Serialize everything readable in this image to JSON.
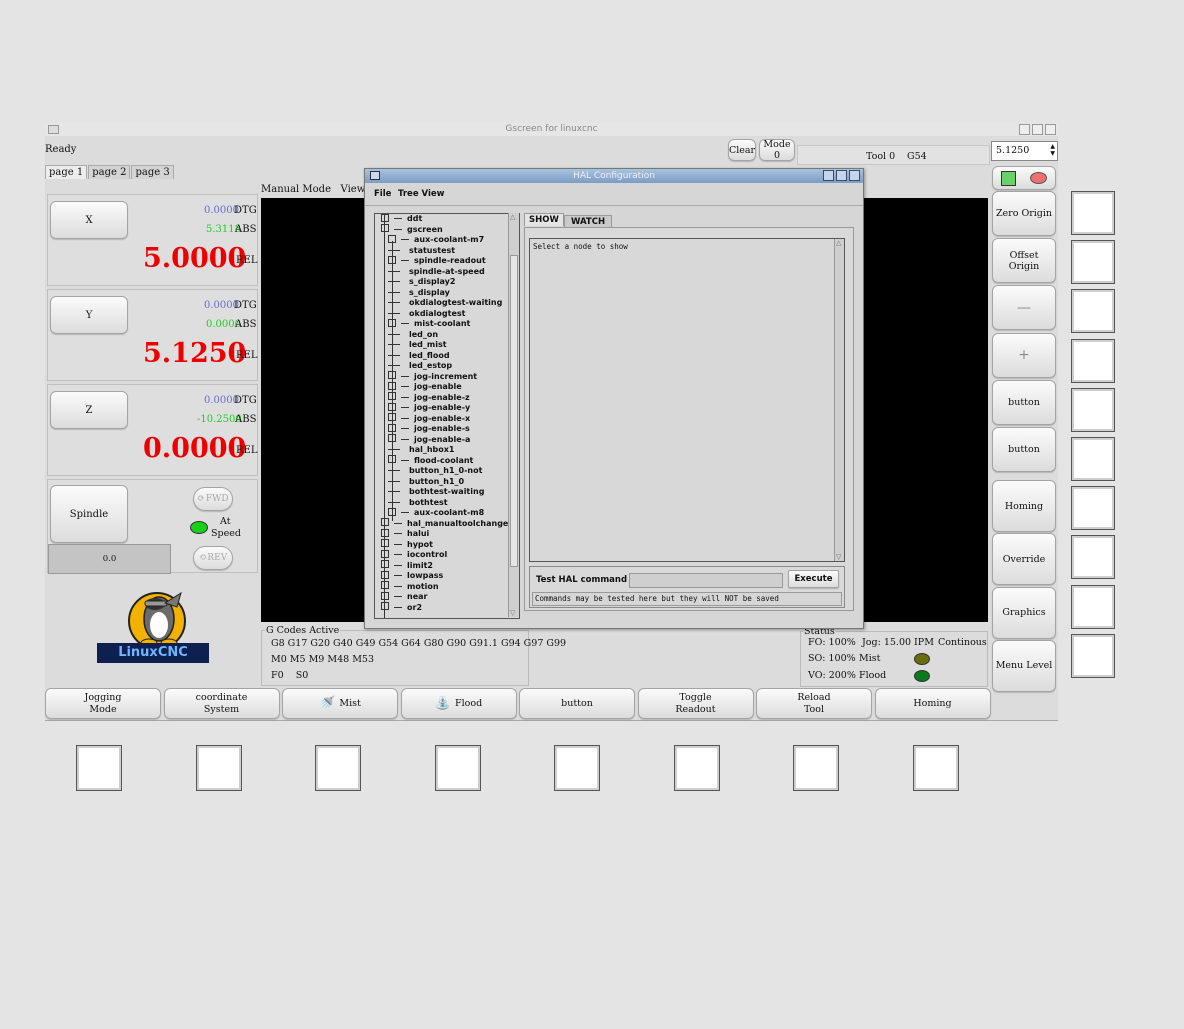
{
  "window": {
    "title": "Gscreen for linuxcnc",
    "status_text": "Ready",
    "clear_label": "Clear",
    "mode_label": "Mode 0",
    "tool_label": "Tool 0",
    "g54_label": "G54",
    "spin_value": "5.1250"
  },
  "tabs": [
    "page 1",
    "page 2",
    "page 3"
  ],
  "axes": [
    {
      "name": "X",
      "dtg": "0.0000",
      "abs": "5.3118",
      "rel": "5.0000",
      "dtg_label": "DTG",
      "abs_label": "ABS",
      "rel_label": "REL"
    },
    {
      "name": "Y",
      "dtg": "0.0000",
      "abs": "0.0000",
      "rel": "5.1250",
      "dtg_label": "DTG",
      "abs_label": "ABS",
      "rel_label": "REL"
    },
    {
      "name": "Z",
      "dtg": "0.0000",
      "abs": "-10.2500",
      "rel": "0.0000",
      "dtg_label": "DTG",
      "abs_label": "ABS",
      "rel_label": "REL"
    }
  ],
  "spindle": {
    "button": "Spindle",
    "fwd": "FWD",
    "rev": "REV",
    "at_speed_1": "At",
    "at_speed_2": "Speed",
    "speed_value": "0.0"
  },
  "logo_text": "LinuxCNC",
  "view": {
    "mode_text": "Manual Mode",
    "view_text": "View -P"
  },
  "gcodes": {
    "title": "G Codes Active",
    "line1": "G8 G17 G20 G40 G49 G54 G64 G80 G90 G91.1 G94 G97 G99",
    "line2": "M0 M5 M9 M48 M53",
    "line3": "F0    S0"
  },
  "status": {
    "title": "Status",
    "fo": "FO: 100%",
    "so": "SO: 100%",
    "vo": "VO: 200%",
    "jog": "Jog: 15.00 IPM",
    "continous": "Continous",
    "mist": "Mist",
    "flood": "Flood",
    "colors": {
      "mist": "#6b6b10",
      "flood": "#0a7a1a"
    }
  },
  "right_buttons": [
    "Zero Origin",
    "Offset Origin",
    "—",
    "+",
    "button",
    "button",
    "Homing",
    "Override",
    "Graphics",
    "Menu Level"
  ],
  "bottom_buttons": [
    {
      "l1": "Jogging",
      "l2": "Mode"
    },
    {
      "l1": "coordinate",
      "l2": "System"
    },
    {
      "l1": "Mist",
      "l2": ""
    },
    {
      "l1": "Flood",
      "l2": ""
    },
    {
      "l1": "button",
      "l2": ""
    },
    {
      "l1": "Toggle",
      "l2": "Readout"
    },
    {
      "l1": "Reload",
      "l2": "Tool"
    },
    {
      "l1": "Homing",
      "l2": ""
    }
  ],
  "hal": {
    "title": "HAL Configuration",
    "menu_file": "File",
    "menu_tree": "Tree View",
    "tab_show": "SHOW",
    "tab_watch": "WATCH",
    "show_text": "Select a node to show",
    "test_label": "Test HAL command :",
    "execute": "Execute",
    "note": "Commands may be tested here but they will NOT be saved",
    "tree": [
      {
        "label": "ddt",
        "level": 0,
        "exp": true
      },
      {
        "label": "gscreen",
        "level": 0,
        "exp": true
      },
      {
        "label": "aux-coolant-m7",
        "level": 1,
        "exp": true
      },
      {
        "label": "statustest",
        "level": 1,
        "exp": false
      },
      {
        "label": "spindle-readout",
        "level": 1,
        "exp": true
      },
      {
        "label": "spindle-at-speed",
        "level": 1,
        "exp": false
      },
      {
        "label": "s_display2",
        "level": 1,
        "exp": false
      },
      {
        "label": "s_display",
        "level": 1,
        "exp": false
      },
      {
        "label": "okdialogtest-waiting",
        "level": 1,
        "exp": false
      },
      {
        "label": "okdialogtest",
        "level": 1,
        "exp": false
      },
      {
        "label": "mist-coolant",
        "level": 1,
        "exp": true
      },
      {
        "label": "led_on",
        "level": 1,
        "exp": false
      },
      {
        "label": "led_mist",
        "level": 1,
        "exp": false
      },
      {
        "label": "led_flood",
        "level": 1,
        "exp": false
      },
      {
        "label": "led_estop",
        "level": 1,
        "exp": false
      },
      {
        "label": "jog-increment",
        "level": 1,
        "exp": true
      },
      {
        "label": "jog-enable",
        "level": 1,
        "exp": true
      },
      {
        "label": "jog-enable-z",
        "level": 1,
        "exp": true
      },
      {
        "label": "jog-enable-y",
        "level": 1,
        "exp": true
      },
      {
        "label": "jog-enable-x",
        "level": 1,
        "exp": true
      },
      {
        "label": "jog-enable-s",
        "level": 1,
        "exp": true
      },
      {
        "label": "jog-enable-a",
        "level": 1,
        "exp": true
      },
      {
        "label": "hal_hbox1",
        "level": 1,
        "exp": false
      },
      {
        "label": "flood-coolant",
        "level": 1,
        "exp": true
      },
      {
        "label": "button_h1_0-not",
        "level": 1,
        "exp": false
      },
      {
        "label": "button_h1_0",
        "level": 1,
        "exp": false
      },
      {
        "label": "bothtest-waiting",
        "level": 1,
        "exp": false
      },
      {
        "label": "bothtest",
        "level": 1,
        "exp": false
      },
      {
        "label": "aux-coolant-m8",
        "level": 1,
        "exp": true
      },
      {
        "label": "hal_manualtoolchange",
        "level": 0,
        "exp": true
      },
      {
        "label": "halui",
        "level": 0,
        "exp": true
      },
      {
        "label": "hypot",
        "level": 0,
        "exp": true
      },
      {
        "label": "iocontrol",
        "level": 0,
        "exp": true
      },
      {
        "label": "limit2",
        "level": 0,
        "exp": true
      },
      {
        "label": "lowpass",
        "level": 0,
        "exp": true
      },
      {
        "label": "motion",
        "level": 0,
        "exp": true
      },
      {
        "label": "near",
        "level": 0,
        "exp": true
      },
      {
        "label": "or2",
        "level": 0,
        "exp": true
      }
    ]
  }
}
